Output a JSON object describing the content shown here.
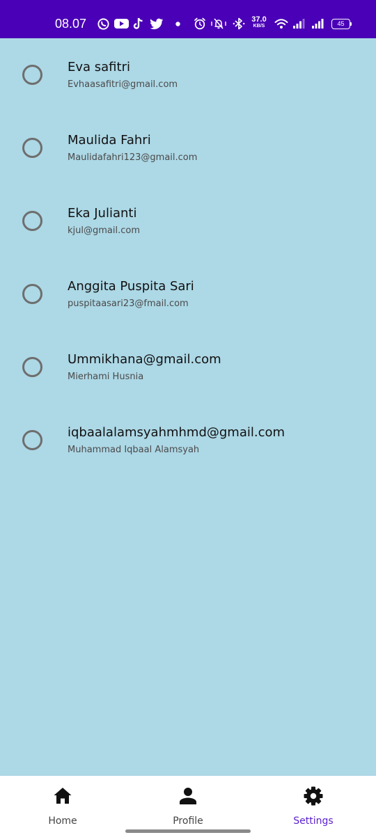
{
  "status_bar": {
    "time": "08.07",
    "net_speed_value": "37.0",
    "net_speed_unit": "KB/S",
    "battery": "45",
    "icons": [
      "whatsapp-icon",
      "youtube-icon",
      "tiktok-icon",
      "twitter-icon",
      "dot-icon",
      "alarm-icon",
      "mute-icon",
      "bluetooth-icon",
      "wifi-icon",
      "signal-icon",
      "signal-icon",
      "battery-icon"
    ],
    "background": "#4a00b6"
  },
  "contacts": [
    {
      "primary": "Eva safitri",
      "secondary": "Evhaasafitri@gmail.com"
    },
    {
      "primary": "Maulida Fahri",
      "secondary": "Maulidafahri123@gmail.com"
    },
    {
      "primary": "Eka Julianti",
      "secondary": "kjul@gmail.com"
    },
    {
      "primary": "Anggita Puspita Sari",
      "secondary": "puspitaasari23@fmail.com"
    },
    {
      "primary": "Ummikhana@gmail.com",
      "secondary": "Mierhami Husnia"
    },
    {
      "primary": "iqbaalalamsyahmhmd@gmail.com",
      "secondary": "Muhammad Iqbaal Alamsyah"
    }
  ],
  "bottom_nav": {
    "items": [
      {
        "label": "Home",
        "icon": "home-icon",
        "active": false
      },
      {
        "label": "Profile",
        "icon": "person-icon",
        "active": false
      },
      {
        "label": "Settings",
        "icon": "gear-icon",
        "active": true
      }
    ],
    "active_color": "#5a1fd0"
  },
  "colors": {
    "page_background": "#add8e6",
    "radio_border": "#6e6e6e"
  }
}
